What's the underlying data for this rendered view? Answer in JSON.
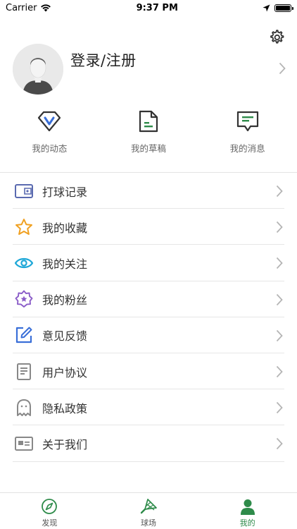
{
  "status": {
    "carrier": "Carrier",
    "time": "9:37 PM"
  },
  "profile": {
    "name": "登录/注册"
  },
  "quick_actions": [
    {
      "label": "我的动态",
      "icon": "diamond-v-icon"
    },
    {
      "label": "我的草稿",
      "icon": "draft-file-icon"
    },
    {
      "label": "我的消息",
      "icon": "message-icon"
    }
  ],
  "menu": [
    {
      "label": "打球记录",
      "icon": "video-camera-icon"
    },
    {
      "label": "我的收藏",
      "icon": "star-icon"
    },
    {
      "label": "我的关注",
      "icon": "eye-icon"
    },
    {
      "label": "我的粉丝",
      "icon": "badge-star-icon"
    },
    {
      "label": "意见反馈",
      "icon": "edit-icon"
    },
    {
      "label": "用户协议",
      "icon": "document-icon"
    },
    {
      "label": "隐私政策",
      "icon": "ghost-icon"
    },
    {
      "label": "关于我们",
      "icon": "id-card-icon"
    }
  ],
  "tabs": [
    {
      "label": "发现",
      "icon": "compass-icon"
    },
    {
      "label": "球场",
      "icon": "shuttlecock-icon"
    },
    {
      "label": "我的",
      "icon": "person-icon",
      "active": true
    }
  ],
  "colors": {
    "accent_green": "#2e8b4a",
    "icon_blue": "#3a6fd8",
    "star_orange": "#f0a020",
    "eye_cyan": "#1fa8d8",
    "purple": "#8a5cc8"
  }
}
